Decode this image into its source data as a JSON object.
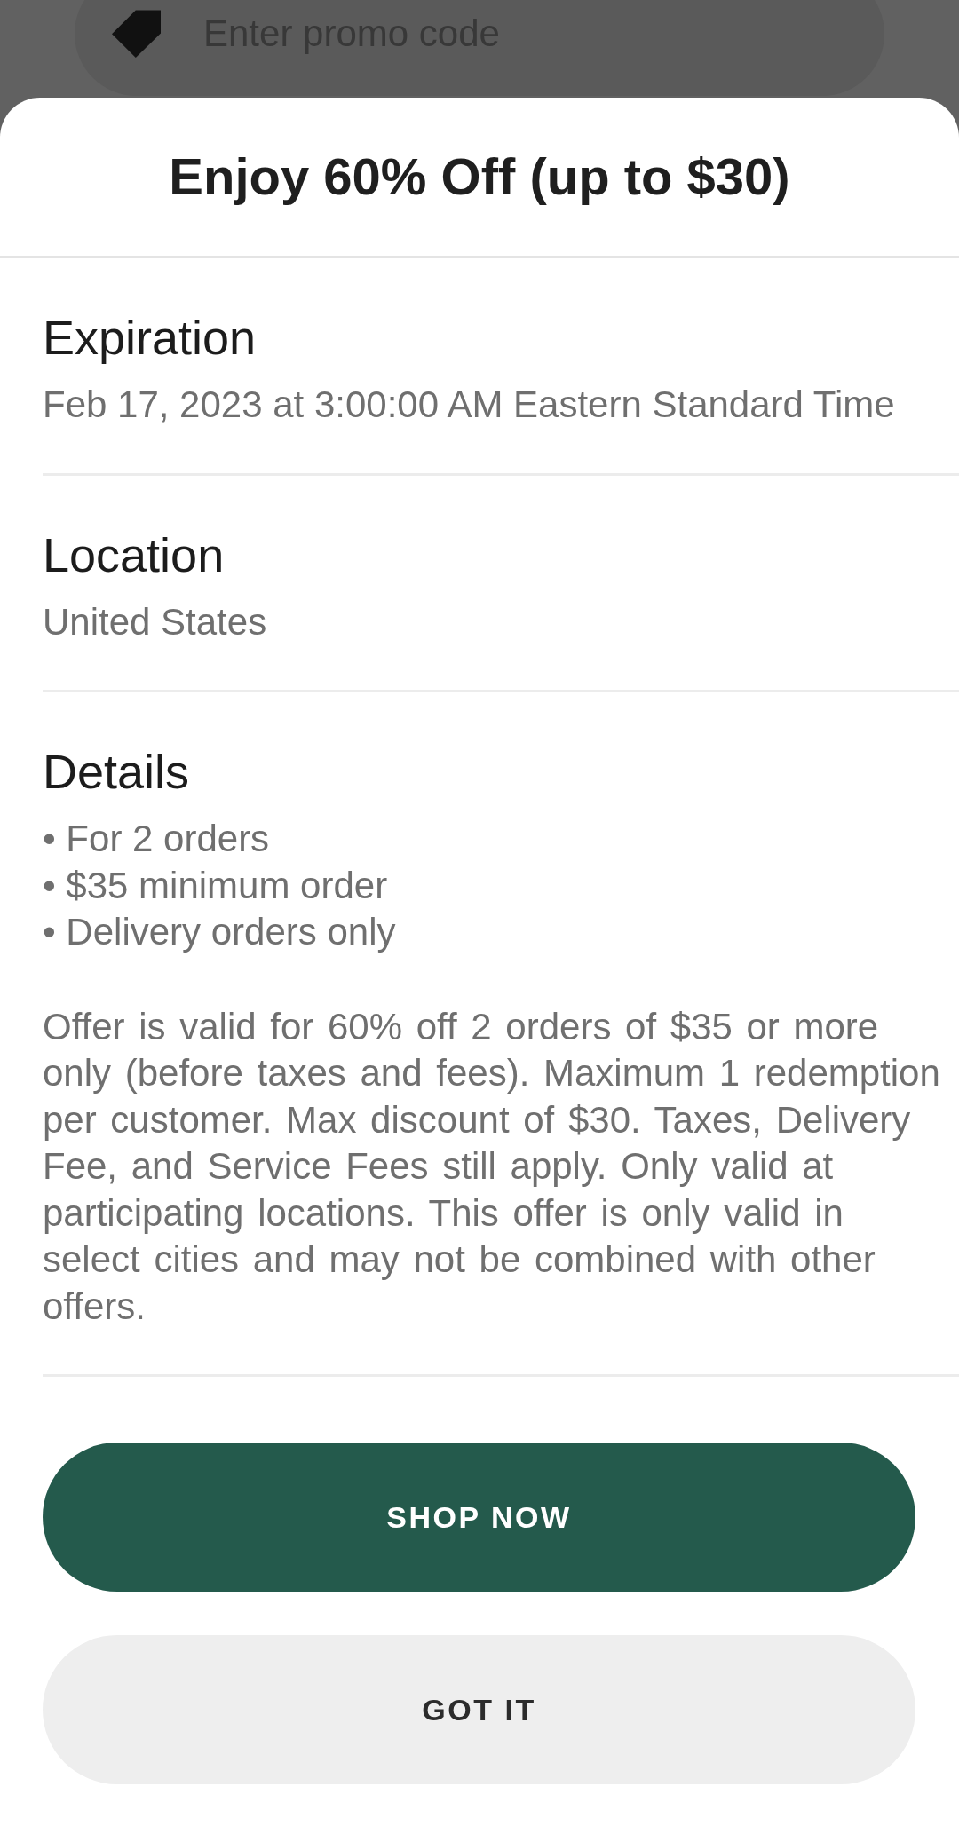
{
  "background": {
    "promo_field": {
      "placeholder": "Enter promo code"
    }
  },
  "sheet": {
    "title": "Enjoy 60% Off (up to $30)",
    "sections": [
      {
        "heading": "Expiration",
        "text": "Feb 17, 2023 at 3:00:00 AM Eastern Standard Time"
      },
      {
        "heading": "Location",
        "text": "United States"
      },
      {
        "heading": "Details",
        "bullets": [
          "• For 2 orders",
          "• $35 minimum order",
          "• Delivery orders only"
        ],
        "text": "Offer is valid for 60% off 2 orders of $35 or more only (before taxes and fees). Maximum 1 redemption per customer. Max discount of $30. Taxes, Delivery Fee, and Service Fees still apply. Only valid at participating locations. This offer is only valid in select cities and may not be combined with other offers."
      }
    ],
    "buttons": [
      {
        "label": "SHOP NOW",
        "kind": "primary"
      },
      {
        "label": "GOT IT",
        "kind": "secondary"
      }
    ]
  }
}
